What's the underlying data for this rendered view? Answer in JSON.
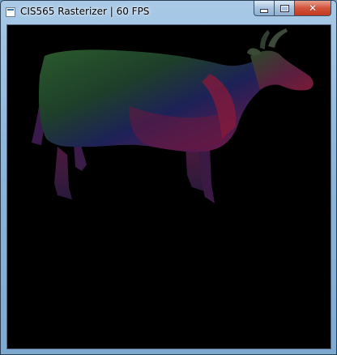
{
  "window": {
    "title": "CIS565 Rasterizer | 60 FPS",
    "title_icon": "application-icon",
    "buttons": {
      "minimize_icon": "minimize-icon",
      "maximize_icon": "maximize-icon",
      "close_label": "✕"
    }
  },
  "canvas": {
    "content": "cow-model-normals-render",
    "background": "#000000",
    "palette": {
      "green": "#1f4a22",
      "blue": "#1d1f5a",
      "red": "#7a1a36",
      "magenta": "#5a1f66"
    }
  }
}
